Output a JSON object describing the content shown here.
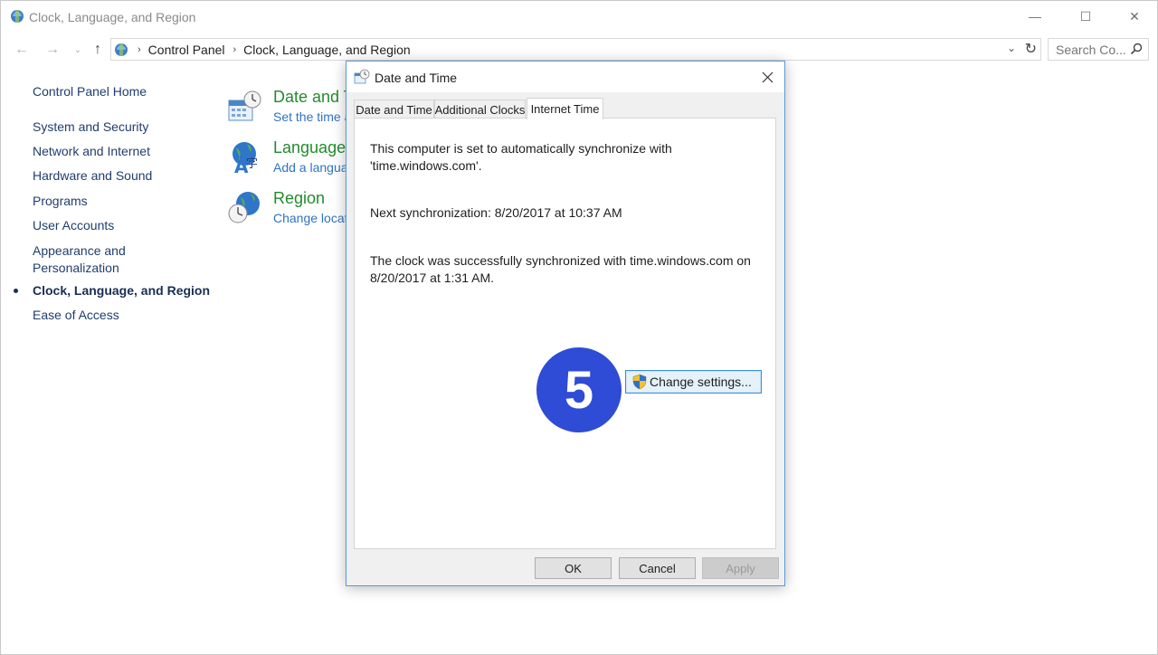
{
  "window": {
    "title": "Clock, Language, and Region",
    "controls": {
      "minimize": "—",
      "maximize": "☐",
      "close": "✕"
    }
  },
  "address": {
    "back": "←",
    "forward": "→",
    "recent": "⌄",
    "up": "↑",
    "crumbs": [
      "Control Panel",
      "Clock, Language, and Region"
    ],
    "separator": "›",
    "dropdown": "⌄",
    "refresh": "↻"
  },
  "search": {
    "placeholder": "Search Co..."
  },
  "sidebar": {
    "home": "Control Panel Home",
    "items": [
      {
        "label": "System and Security"
      },
      {
        "label": "Network and Internet"
      },
      {
        "label": "Hardware and Sound"
      },
      {
        "label": "Programs"
      },
      {
        "label": "User Accounts"
      },
      {
        "label": "Appearance and"
      },
      {
        "label": "Personalization"
      },
      {
        "label": "Clock, Language, and Region",
        "active": true
      },
      {
        "label": "Ease of Access"
      }
    ]
  },
  "categories": [
    {
      "title": "Date and T",
      "link": "Set the time a"
    },
    {
      "title": "Language",
      "link": "Add a langua"
    },
    {
      "title": "Region",
      "link": "Change locati"
    }
  ],
  "dialog": {
    "title": "Date and Time",
    "close": "✕",
    "tabs": [
      {
        "label": "Date and Time"
      },
      {
        "label": "Additional Clocks"
      },
      {
        "label": "Internet Time",
        "selected": true
      }
    ],
    "sync_status_line1": "This computer is set to automatically synchronize with",
    "sync_status_line2": "'time.windows.com'.",
    "next_sync": "Next synchronization: 8/20/2017 at 10:37 AM",
    "last_sync_line1": "The clock was successfully synchronized with time.windows.com on",
    "last_sync_line2": "8/20/2017 at 1:31 AM.",
    "change_settings": "Change settings...",
    "ok": "OK",
    "cancel": "Cancel",
    "apply": "Apply"
  },
  "step_badge": "5",
  "colors": {
    "accent": "#0078d7",
    "link_green": "#238b2e",
    "link_blue": "#2f73c4",
    "badge": "#2e4cd6"
  }
}
